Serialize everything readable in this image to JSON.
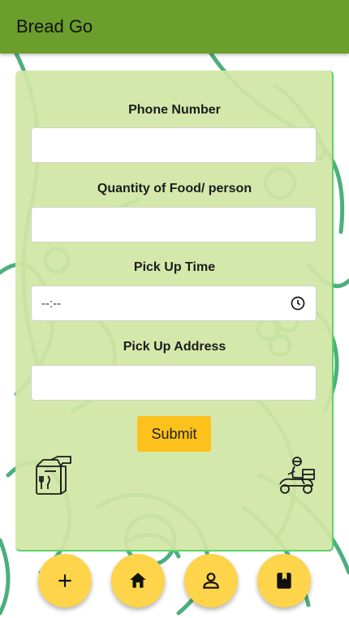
{
  "app": {
    "title": "Bread Go"
  },
  "form": {
    "phone_label": "Phone Number",
    "quantity_label": "Quantity of Food/ person",
    "pickup_time_label": "Pick Up Time",
    "pickup_time_value": "--:--",
    "pickup_address_label": "Pick Up Address",
    "submit_label": "Submit"
  },
  "icons": {
    "bag": "food-bag-icon",
    "rider": "delivery-scooter-icon",
    "clock": "clock-icon"
  },
  "bottom_nav": [
    {
      "icon": "add-icon"
    },
    {
      "icon": "home-icon"
    },
    {
      "icon": "person-icon"
    },
    {
      "icon": "book-icon"
    }
  ],
  "colors": {
    "app_bar": "#6b9e2c",
    "card_bg": "#d2e6a5",
    "card_border": "#5bd36b",
    "submit_button": "#fcc11b",
    "fab": "#fdd44a",
    "background_art": "#4caf7d"
  }
}
